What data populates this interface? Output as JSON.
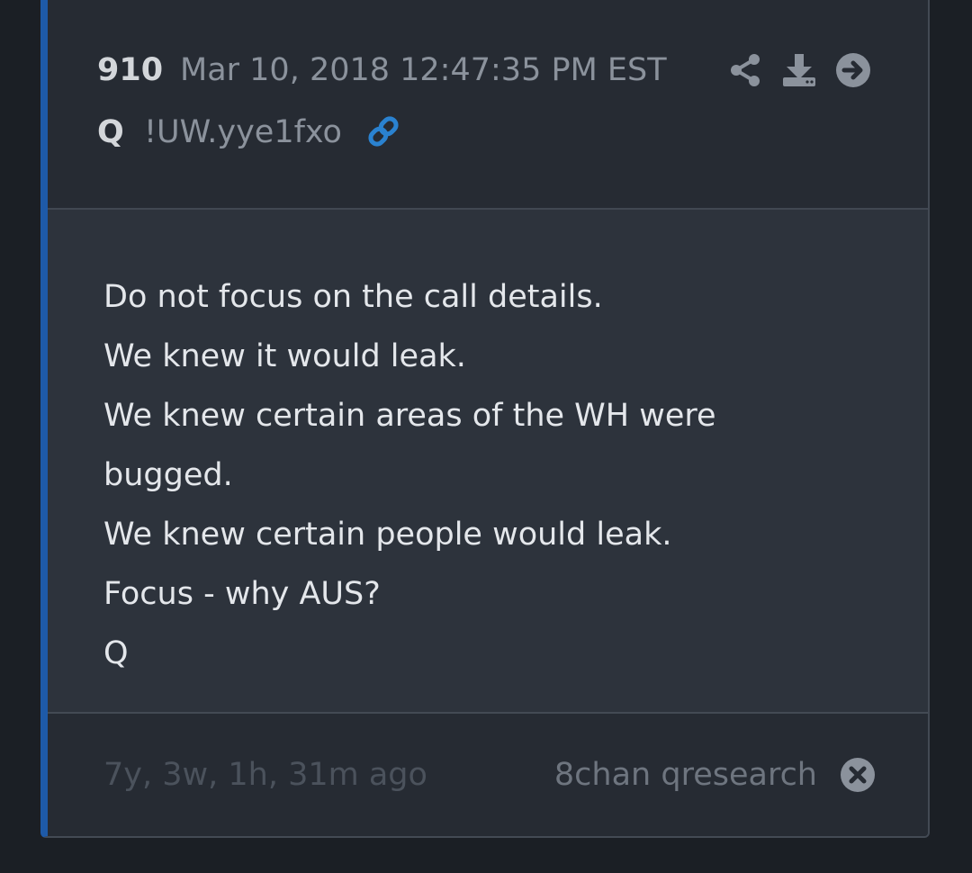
{
  "post": {
    "number": "910",
    "date": "Mar 10, 2018 12:47:35 PM EST",
    "author": "Q",
    "tripcode": "!UW.yye1fxo",
    "body_lines": [
      "Do not focus on the call details.",
      "We knew it would leak.",
      "We knew certain areas of the WH were",
      "bugged.",
      "We knew certain people would leak.",
      "Focus - why AUS?",
      "Q"
    ]
  },
  "footer": {
    "age": "7y, 3w, 1h, 31m ago",
    "source": "8chan qresearch"
  },
  "icons": {
    "share": "share-icon",
    "download": "download-icon",
    "go": "arrow-right-circle-icon",
    "link": "link-icon",
    "close": "close-circle-icon"
  },
  "colors": {
    "accent_bar": "#1e5aa8",
    "link_icon": "#2a82d0",
    "background": "#1b1f25",
    "card": "#262b33",
    "body": "#2d333c"
  }
}
